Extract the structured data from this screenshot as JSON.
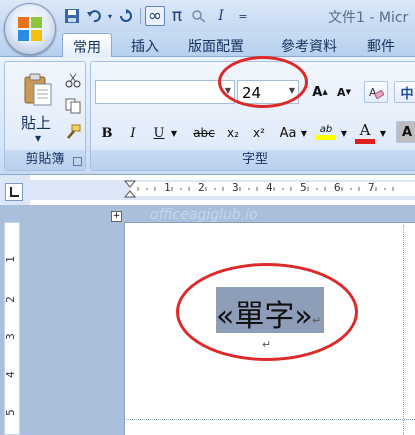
{
  "window": {
    "title": "文件1 - Micr"
  },
  "qat": {
    "more": "="
  },
  "tabs": [
    {
      "label": "常用",
      "active": true
    },
    {
      "label": "插入",
      "active": false
    },
    {
      "label": "版面配置",
      "active": false
    },
    {
      "label": "參考資料",
      "active": false
    },
    {
      "label": "郵件",
      "active": false
    }
  ],
  "clipboard": {
    "paste_label": "貼上",
    "group_label": "剪貼簿"
  },
  "font": {
    "group_label": "字型",
    "font_name": "",
    "font_size": "24",
    "grow": "A",
    "shrink": "A",
    "zhuyin": "中",
    "bold": "B",
    "italic": "I",
    "underline": "U",
    "strike": "abc",
    "subscript": "x₂",
    "superscript": "x²",
    "case": "Aa",
    "highlight": "ab",
    "color": "A",
    "shade": "A"
  },
  "ruler": {
    "h_numbers": [
      "1",
      "2",
      "3",
      "4",
      "5",
      "6",
      "7"
    ],
    "v_numbers": [
      "1",
      "2",
      "3",
      "4",
      "5"
    ]
  },
  "document": {
    "watermark": "officeagiglub.io",
    "field_text": "«單字»",
    "para_mark": "↵"
  },
  "colors": {
    "annotation": "#dc2a2a",
    "highlight": "#ffff00",
    "font_color": "#e02020"
  }
}
